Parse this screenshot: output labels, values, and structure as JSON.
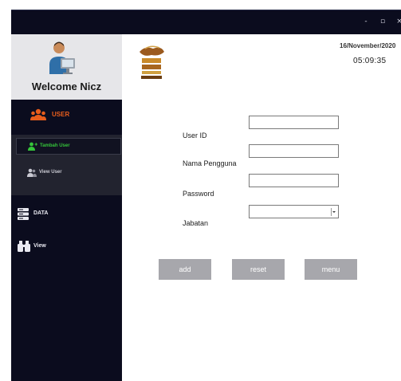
{
  "window": {
    "controls": {
      "minimize": "-",
      "maximize": "▫",
      "close": "×"
    }
  },
  "sidebar": {
    "welcome": "Welcome Nicz",
    "menu": {
      "user": {
        "label": "USER",
        "icon": "users-icon"
      },
      "data": {
        "label": "DATA",
        "icon": "database-icon"
      },
      "view": {
        "label": "View",
        "icon": "binoculars-icon"
      }
    },
    "submenu": {
      "tambah_user": {
        "label": "Tambah User",
        "icon": "add-user-icon"
      },
      "view_user": {
        "label": "View User",
        "icon": "users-icon"
      }
    }
  },
  "header": {
    "date": "16/November/2020",
    "time": "05:09:35",
    "logo_icon": "restaurant-logo-icon"
  },
  "form": {
    "user_id": {
      "label": "User ID",
      "value": ""
    },
    "nama_pengguna": {
      "label": "Nama Pengguna",
      "value": ""
    },
    "password": {
      "label": "Password",
      "value": ""
    },
    "jabatan": {
      "label": "Jabatan",
      "value": ""
    }
  },
  "buttons": {
    "add": "add",
    "reset": "reset",
    "menu": "menu"
  },
  "colors": {
    "sidebar_bg": "#0b0c1e",
    "profile_bg": "#e6e6e9",
    "accent_orange": "#e85d1c",
    "accent_green": "#35c43a",
    "button_bg": "#a7a7ac"
  }
}
